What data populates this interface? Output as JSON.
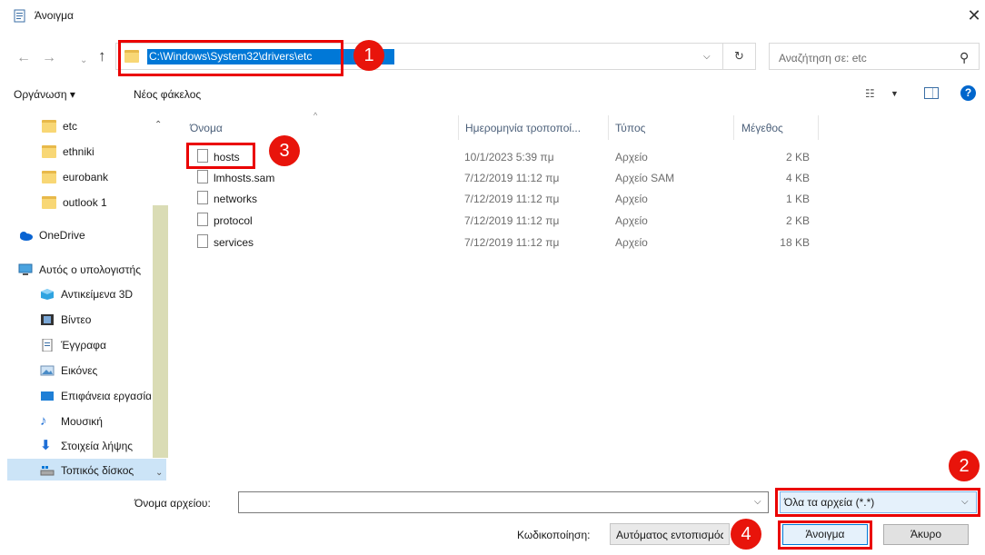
{
  "window": {
    "title": "Άνοιγμα",
    "close_glyph": "✕"
  },
  "nav": {
    "back_glyph": "←",
    "forward_glyph": "→",
    "recent_glyph": "⌄",
    "up_glyph": "↑",
    "address": "C:\\Windows\\System32\\drivers\\etc",
    "refresh_glyph": "↻",
    "search_placeholder": "Αναζήτηση σε: etc"
  },
  "toolbar": {
    "organize": "Οργάνωση ▾",
    "new_folder": "Νέος φάκελος",
    "view_caret": "▼"
  },
  "sidebar": {
    "items": [
      {
        "label": "etc",
        "icon": "folder-icon"
      },
      {
        "label": "ethniki",
        "icon": "folder-icon"
      },
      {
        "label": "eurobank",
        "icon": "folder-icon"
      },
      {
        "label": "outlook 1",
        "icon": "folder-icon"
      },
      {
        "label": "OneDrive",
        "icon": "cloud-icon"
      },
      {
        "label": "Αυτός ο υπολογιστής",
        "icon": "computer-icon"
      },
      {
        "label": "Αντικείμενα 3D",
        "icon": "3d-objects-icon"
      },
      {
        "label": "Βίντεο",
        "icon": "video-icon"
      },
      {
        "label": "Έγγραφα",
        "icon": "documents-icon"
      },
      {
        "label": "Εικόνες",
        "icon": "pictures-icon"
      },
      {
        "label": "Επιφάνεια εργασίας",
        "icon": "desktop-icon"
      },
      {
        "label": "Μουσική",
        "icon": "music-icon"
      },
      {
        "label": "Στοιχεία λήψης",
        "icon": "downloads-icon"
      },
      {
        "label": "Τοπικός δίσκος",
        "icon": "local-disk-icon"
      }
    ]
  },
  "columns": {
    "name": "Όνομα",
    "date": "Ημερομηνία τροποποί...",
    "type": "Τύπος",
    "size": "Μέγεθος"
  },
  "files": [
    {
      "name": "hosts",
      "date": "10/1/2023 5:39 πμ",
      "type": "Αρχείο",
      "size": "2 KB"
    },
    {
      "name": "lmhosts.sam",
      "date": "7/12/2019 11:12 πμ",
      "type": "Αρχείο SAM",
      "size": "4 KB"
    },
    {
      "name": "networks",
      "date": "7/12/2019 11:12 πμ",
      "type": "Αρχείο",
      "size": "1 KB"
    },
    {
      "name": "protocol",
      "date": "7/12/2019 11:12 πμ",
      "type": "Αρχείο",
      "size": "2 KB"
    },
    {
      "name": "services",
      "date": "7/12/2019 11:12 πμ",
      "type": "Αρχείο",
      "size": "18 KB"
    }
  ],
  "bottom": {
    "filename_label": "Όνομα αρχείου:",
    "filename_value": "",
    "filetype": "Όλα τα αρχεία  (*.*)",
    "encoding_label": "Κωδικοποίηση:",
    "encoding_value": "Αυτόματος εντοπισμός",
    "open": "Άνοιγμα",
    "cancel": "Άκυρο"
  },
  "annotations": {
    "step1": "1",
    "step2": "2",
    "step3": "3",
    "step4": "4"
  },
  "colors": {
    "annotation_red": "#e8140b",
    "selection_blue": "#0078d7",
    "folder_yellow": "#f8d775"
  }
}
